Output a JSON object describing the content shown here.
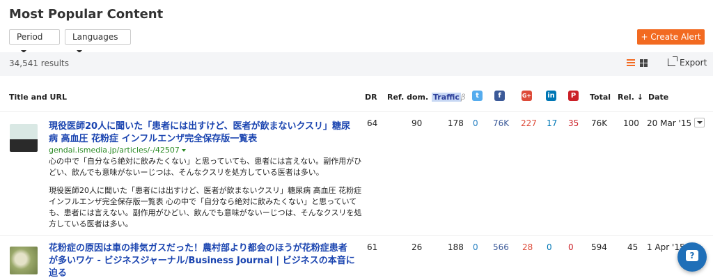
{
  "header": {
    "title": "Most Popular Content",
    "period_label": "Period",
    "languages_label": "Languages",
    "create_alert_label": "+ Create Alert"
  },
  "toolbar": {
    "results_count": "34,541 results",
    "export_label": "Export",
    "accent": "#f26a21"
  },
  "columns": {
    "title": "Title and URL",
    "dr": "DR",
    "ref_dom": "Ref. dom.",
    "traffic": "Traffic",
    "traffic_beta": "β",
    "total": "Total",
    "rel": "Rel. ↓",
    "date": "Date"
  },
  "social_icons": [
    "twitter-icon",
    "facebook-icon",
    "google-plus-icon",
    "linkedin-icon",
    "pinterest-icon"
  ],
  "rows": [
    {
      "title": "現役医師20人に聞いた「患者には出すけど、医者が飲まないクスリ」糖尿病 高血圧 花粉症 インフルエンザ完全保存版一覧表",
      "url": "gendai.ismedia.jp/articles/-/42507",
      "snippet_1": "心の中で「自分なら絶対に飲みたくない」と思っていても、患者には言えない。副作用がひどい、飲んでも意味がないーじつは、そんなクスリを処方している医者は多い。",
      "snippet_2": "現役医師20人に聞いた「患者には出すけど、医者が飲まないクスリ」糖尿病 高血圧 花粉症 インフルエンザ完全保存版一覧表 心の中で「自分なら絶対に飲みたくない」と思っていても、患者には言えない。副作用がひどい、飲んでも意味がないーじつは、そんなクスリを処方している医者は多い。",
      "dr": "64",
      "ref_dom": "90",
      "traffic": "178",
      "twitter": "0",
      "facebook": "76K",
      "google_plus": "227",
      "linkedin": "17",
      "pinterest": "35",
      "total": "76K",
      "rel": "100",
      "date": "20 Mar '15"
    },
    {
      "title": "花粉症の原因は車の排気ガスだった！農村部より都会のほうが花粉症患者が多いワケ - ビジネスジャーナル/Business Journal | ビジネスの本音に迫る",
      "dr": "61",
      "ref_dom": "26",
      "traffic": "188",
      "twitter": "0",
      "facebook": "566",
      "google_plus": "28",
      "linkedin": "0",
      "pinterest": "0",
      "total": "594",
      "rel": "45",
      "date": "1 Apr '15"
    }
  ]
}
